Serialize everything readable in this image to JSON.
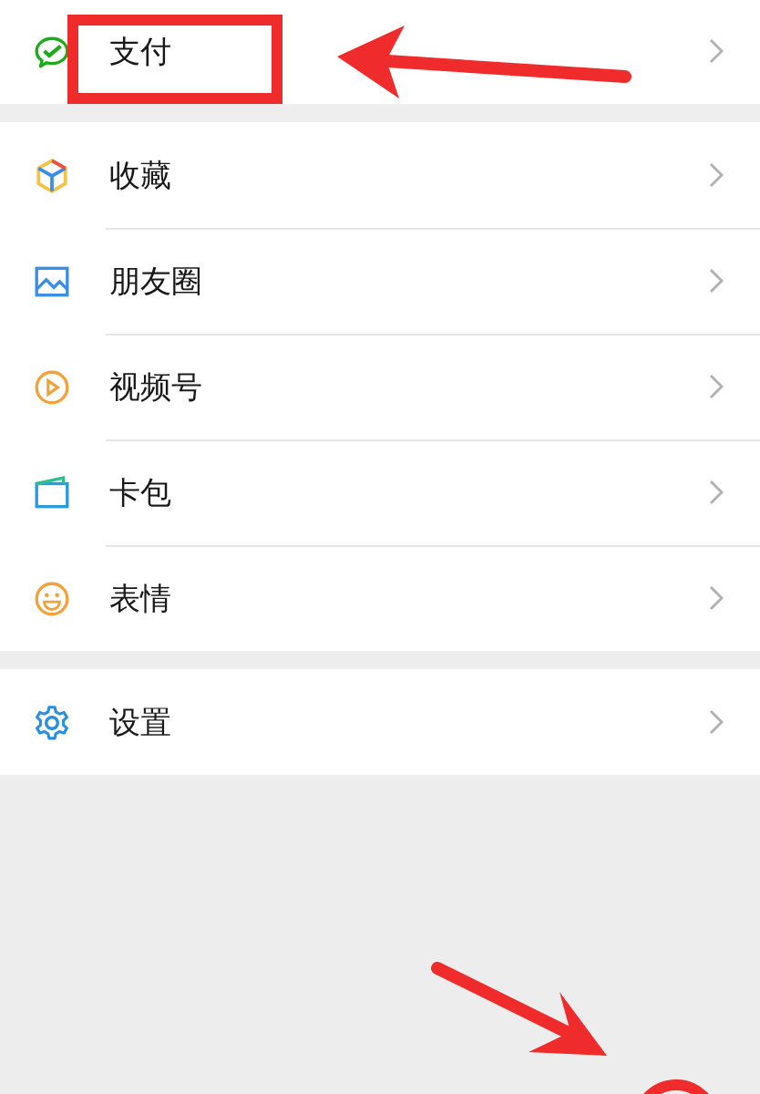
{
  "sections": [
    {
      "items": [
        {
          "label": "支付"
        }
      ]
    },
    {
      "items": [
        {
          "label": "收藏"
        },
        {
          "label": "朋友圈"
        },
        {
          "label": "视频号"
        },
        {
          "label": "卡包"
        },
        {
          "label": "表情"
        }
      ]
    },
    {
      "items": [
        {
          "label": "设置"
        }
      ]
    }
  ],
  "annotations": [
    {
      "kind": "box"
    },
    {
      "kind": "arrow"
    },
    {
      "kind": "arrow"
    },
    {
      "kind": "circle"
    }
  ]
}
